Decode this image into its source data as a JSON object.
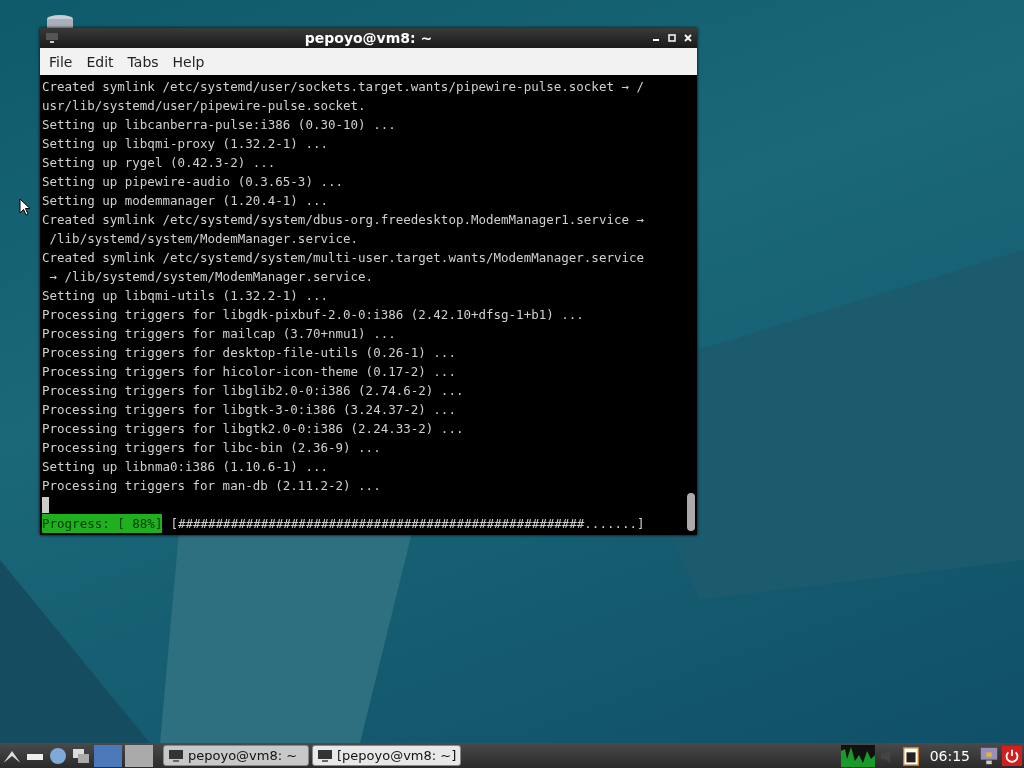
{
  "window": {
    "title": "pepoyo@vm8: ~",
    "menu": [
      "File",
      "Edit",
      "Tabs",
      "Help"
    ],
    "lines": [
      "Created symlink /etc/systemd/user/sockets.target.wants/pipewire-pulse.socket → /",
      "usr/lib/systemd/user/pipewire-pulse.socket.",
      "Setting up libcanberra-pulse:i386 (0.30-10) ...",
      "Setting up libqmi-proxy (1.32.2-1) ...",
      "Setting up rygel (0.42.3-2) ...",
      "Setting up pipewire-audio (0.3.65-3) ...",
      "Setting up modemmanager (1.20.4-1) ...",
      "Created symlink /etc/systemd/system/dbus-org.freedesktop.ModemManager1.service →",
      " /lib/systemd/system/ModemManager.service.",
      "Created symlink /etc/systemd/system/multi-user.target.wants/ModemManager.service",
      " → /lib/systemd/system/ModemManager.service.",
      "Setting up libqmi-utils (1.32.2-1) ...",
      "Processing triggers for libgdk-pixbuf-2.0-0:i386 (2.42.10+dfsg-1+b1) ...",
      "Processing triggers for mailcap (3.70+nmu1) ...",
      "Processing triggers for desktop-file-utils (0.26-1) ...",
      "Processing triggers for hicolor-icon-theme (0.17-2) ...",
      "Processing triggers for libglib2.0-0:i386 (2.74.6-2) ...",
      "Processing triggers for libgtk-3-0:i386 (3.24.37-2) ...",
      "Processing triggers for libgtk2.0-0:i386 (2.24.33-2) ...",
      "Processing triggers for libc-bin (2.36-9) ...",
      "Setting up libnma0:i386 (1.10.6-1) ...",
      "Processing triggers for man-db (2.11.2-2) ..."
    ],
    "progress": {
      "label": "Progress: [ 88%]",
      "bar": "[######################################################.......]"
    }
  },
  "taskbar": {
    "tasks": [
      {
        "label": "pepoyo@vm8: ~",
        "selected": true
      },
      {
        "label": "[pepoyo@vm8: ~]",
        "selected": false
      }
    ],
    "clock": "06:15"
  }
}
